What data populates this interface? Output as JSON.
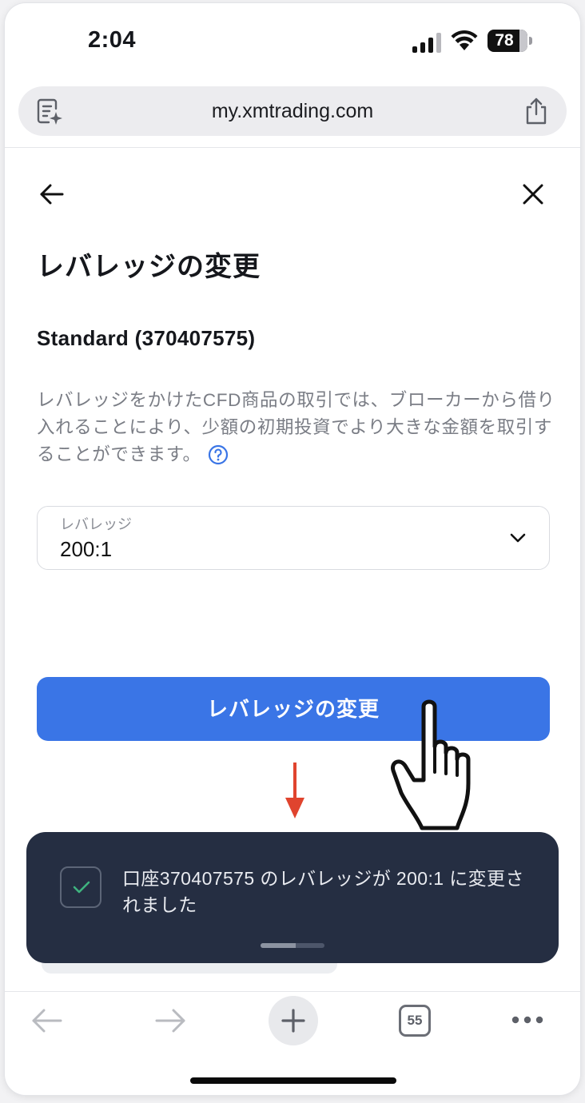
{
  "status_bar": {
    "time": "2:04",
    "battery": "78"
  },
  "browser": {
    "url": "my.xmtrading.com",
    "tab_count": "55"
  },
  "page": {
    "title": "レバレッジの変更",
    "account": "Standard (370407575)",
    "description": "レバレッジをかけたCFD商品の取引では、ブローカーから借り入れることにより、少額の初期投資でより大きな金額を取引することができます。",
    "select": {
      "label": "レバレッジ",
      "value": "200:1"
    },
    "submit_label": "レバレッジの変更"
  },
  "toast": {
    "message": "口座370407575 のレバレッジが 200:1 に変更されました",
    "progress": 0.55
  },
  "colors": {
    "primary": "#3a75e6",
    "toast_bg": "#252e42",
    "success": "#3fb37f",
    "annotation_arrow": "#e0442e"
  },
  "icons": [
    "page-icon",
    "share-icon",
    "back-arrow-icon",
    "close-icon",
    "help-icon",
    "chevron-down-icon",
    "hand-cursor-icon",
    "down-arrow-icon",
    "check-icon",
    "back-icon",
    "forward-icon",
    "plus-icon",
    "tabs-icon",
    "more-icon"
  ]
}
